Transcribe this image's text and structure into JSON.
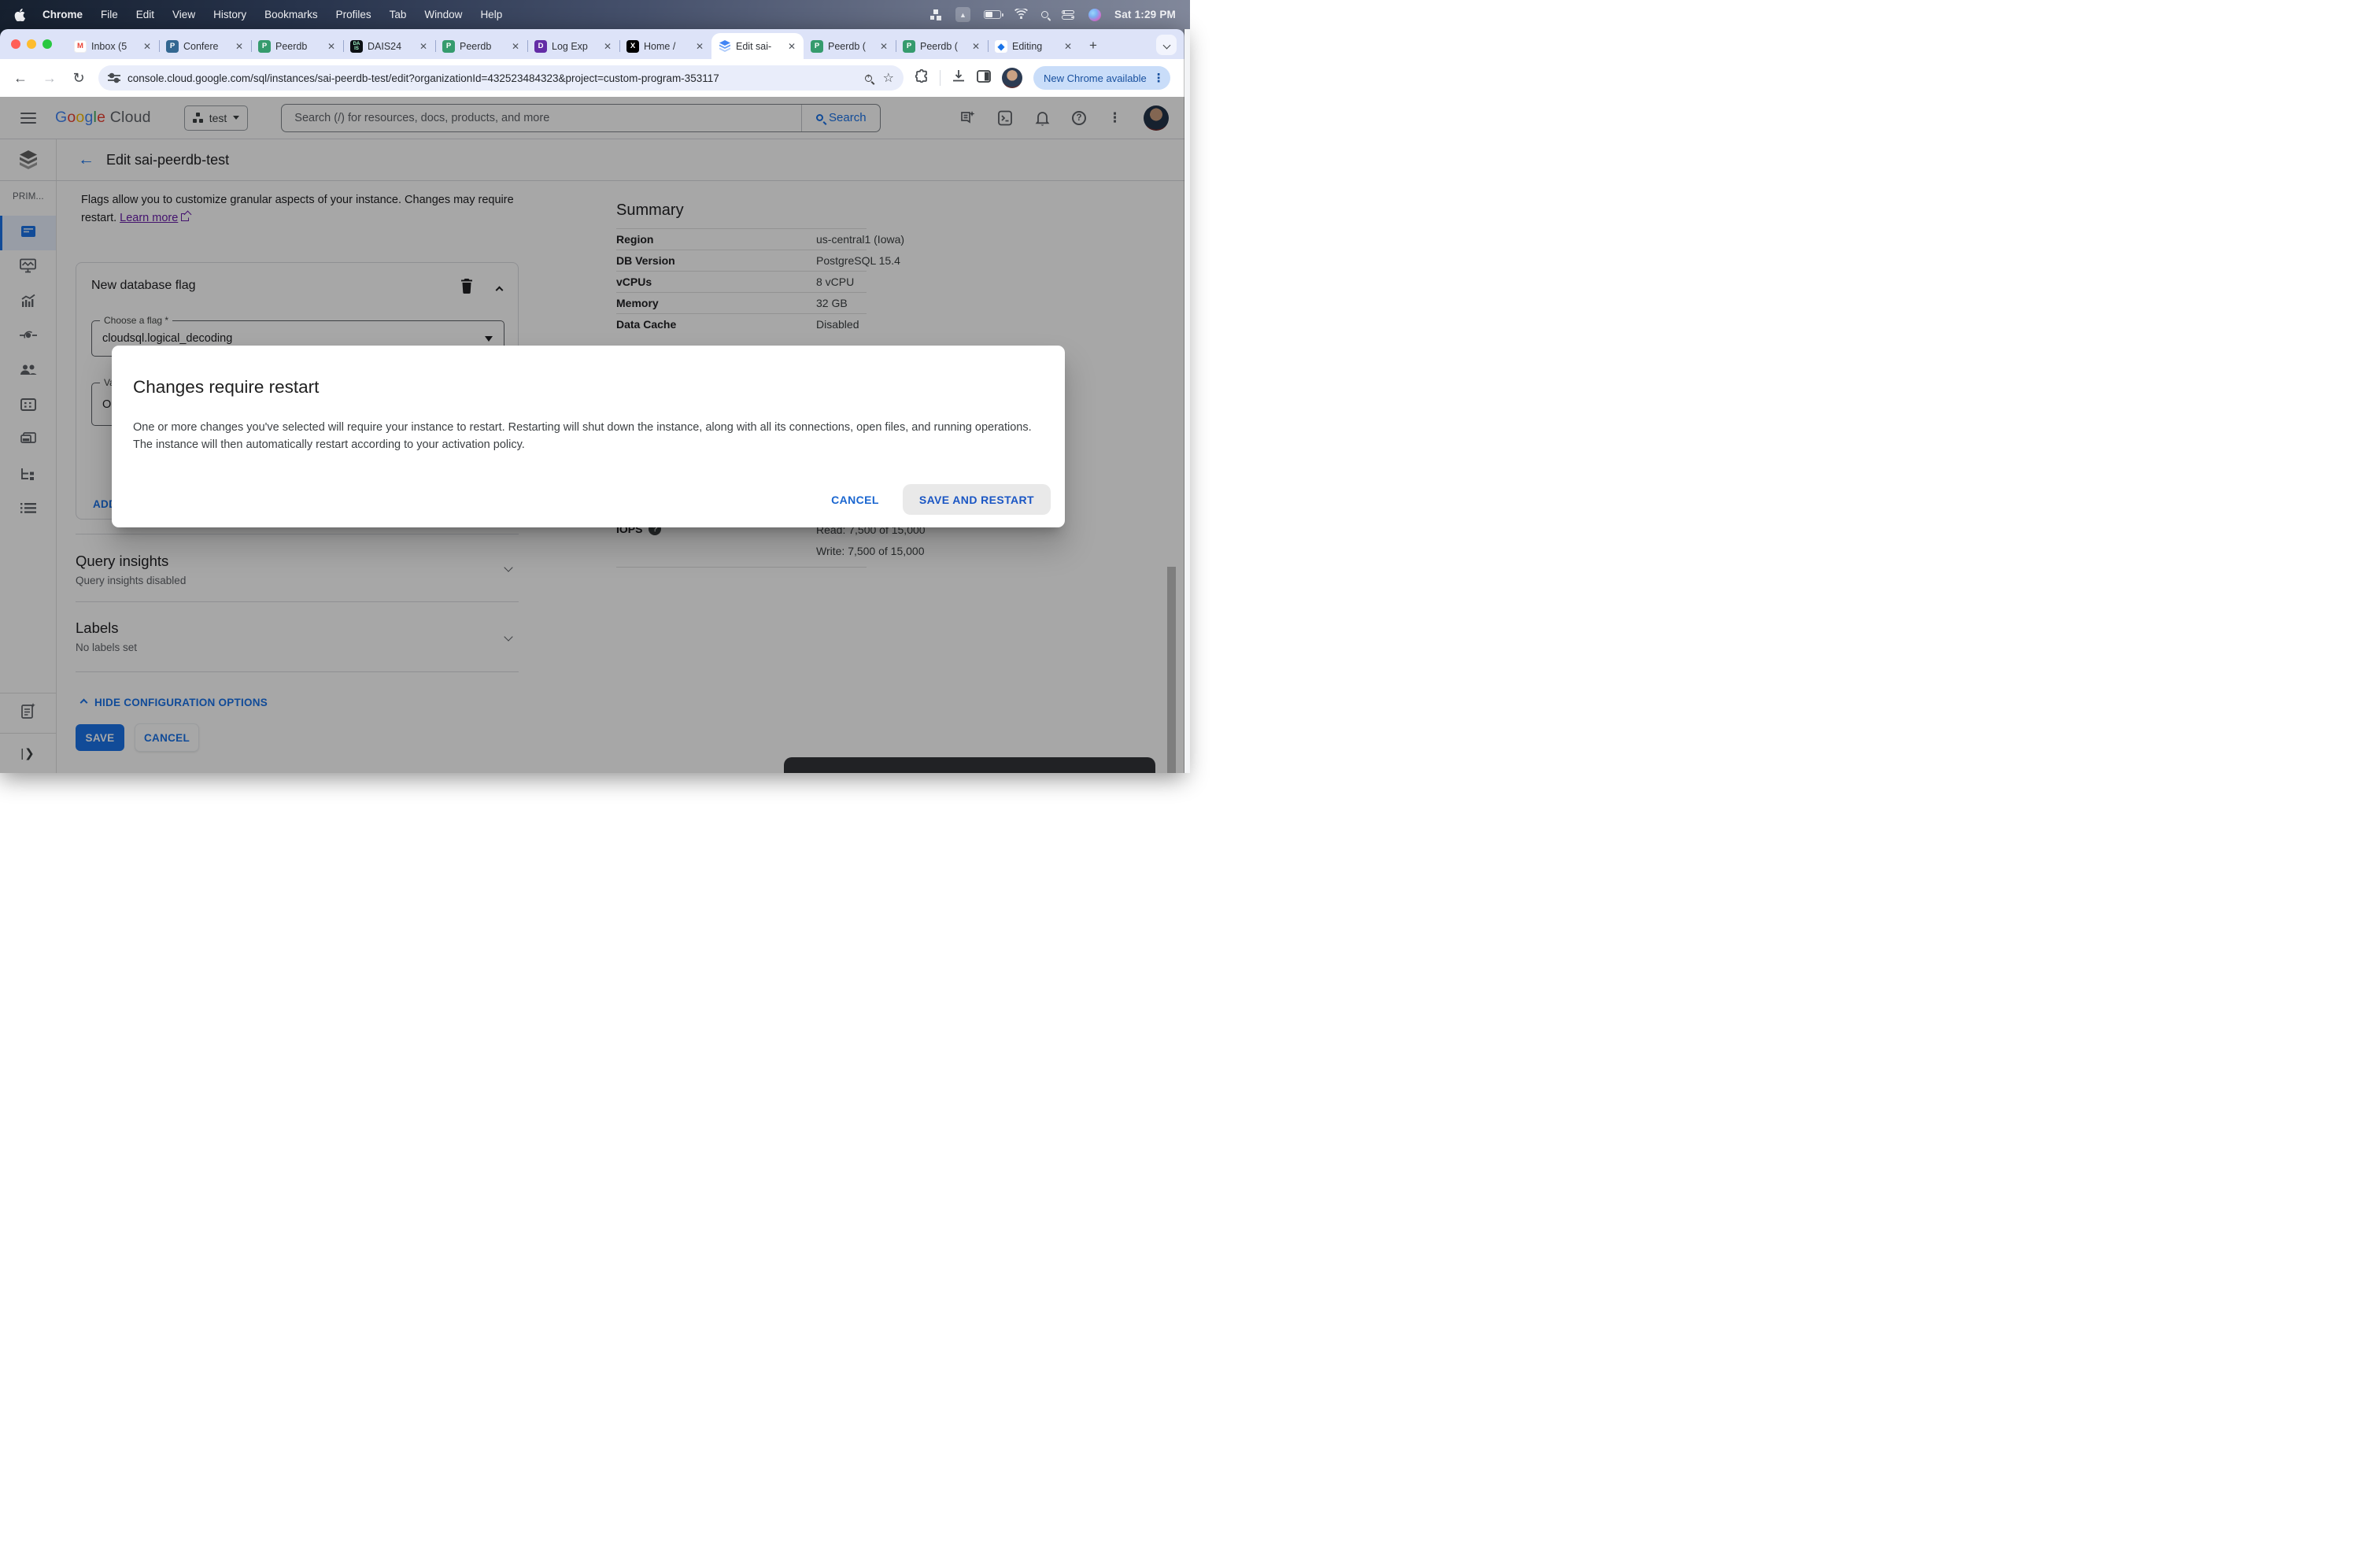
{
  "os": {
    "menu_items": [
      "Chrome",
      "File",
      "Edit",
      "View",
      "History",
      "Bookmarks",
      "Profiles",
      "Tab",
      "Window",
      "Help"
    ],
    "clock": "Sat 1:29 PM"
  },
  "browser": {
    "tabs": [
      {
        "title": "Inbox (5",
        "favicon": "gmail"
      },
      {
        "title": "Confere",
        "favicon": "postgres"
      },
      {
        "title": "Peerdb",
        "favicon": "peerdb"
      },
      {
        "title": "DAIS24",
        "favicon": "dais"
      },
      {
        "title": "Peerdb",
        "favicon": "peerdb"
      },
      {
        "title": "Log Exp",
        "favicon": "datadog"
      },
      {
        "title": "Home /",
        "favicon": "x"
      },
      {
        "title": "Edit sai-",
        "favicon": "cloudsql",
        "active": true
      },
      {
        "title": "Peerdb (",
        "favicon": "peerdb"
      },
      {
        "title": "Peerdb (",
        "favicon": "peerdb"
      },
      {
        "title": "Editing",
        "favicon": "maps"
      }
    ],
    "url": "console.cloud.google.com/sql/instances/sai-peerdb-test/edit?organizationId=432523484323&project=custom-program-353117",
    "update_pill": "New Chrome available"
  },
  "gcloud": {
    "logo": "Google Cloud",
    "project": "test",
    "search_placeholder": "Search (/) for resources, docs, products, and more",
    "search_button": "Search",
    "page_title": "Edit sai-peerdb-test",
    "sidebar_label": "PRIM...",
    "sidebar_items": [
      "overview",
      "monitoring",
      "system-insights",
      "connections",
      "users",
      "databases",
      "backups",
      "replicas",
      "operations"
    ]
  },
  "content": {
    "intro_text": "Flags allow you to customize granular aspects of your instance. Changes may require restart. ",
    "learn_more": "Learn more",
    "card": {
      "title": "New database flag",
      "flag_label": "Choose a flag *",
      "flag_value": "cloudsql.logical_decoding",
      "value_label": "Val",
      "value_text": "On",
      "add_button": "ADD"
    },
    "query_insights": {
      "title": "Query insights",
      "subtitle": "Query insights disabled"
    },
    "labels": {
      "title": "Labels",
      "subtitle": "No labels set"
    },
    "hide_options": "HIDE CONFIGURATION OPTIONS",
    "save": "SAVE",
    "cancel": "CANCEL"
  },
  "summary": {
    "title": "Summary",
    "rows": [
      {
        "label": "Region",
        "value": "us-central1 (Iowa)"
      },
      {
        "label": "DB Version",
        "value": "PostgreSQL 15.4"
      },
      {
        "label": "vCPUs",
        "value": "8 vCPU"
      },
      {
        "label": "Memory",
        "value": "32 GB"
      },
      {
        "label": "Data Cache",
        "value": "Disabled"
      }
    ],
    "iops": {
      "label": "IOPS",
      "read": "Read: 7,500 of 15,000",
      "write": "Write: 7,500 of 15,000"
    }
  },
  "dialog": {
    "title": "Changes require restart",
    "body": "One or more changes you've selected will require your instance to restart. Restarting will shut down the instance, along with all its connections, open files, and running operations. The instance will then automatically restart according to your activation policy.",
    "cancel": "CANCEL",
    "confirm": "SAVE AND RESTART"
  },
  "colors": {
    "accent": "#1a73e8",
    "visited_link": "#681da8",
    "save_button": "#1a73e8"
  }
}
